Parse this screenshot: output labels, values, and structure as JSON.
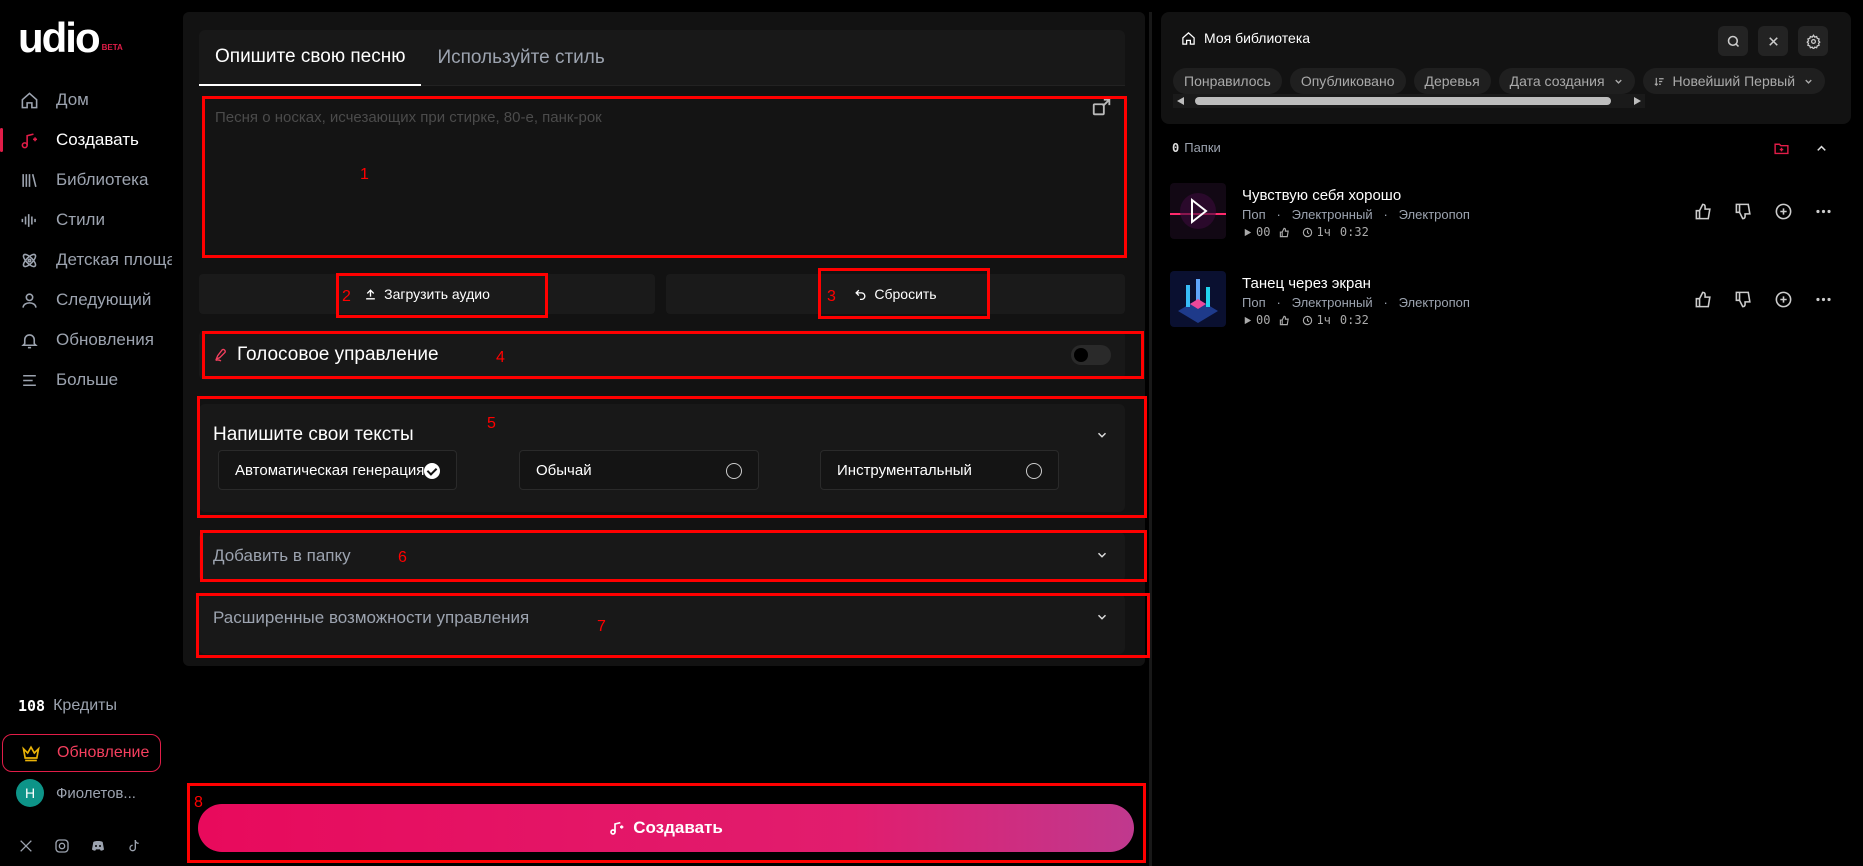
{
  "brand": {
    "logo": "udio",
    "beta": "BETA"
  },
  "sidebar": {
    "items": [
      {
        "label": "Дом",
        "icon": "home-icon"
      },
      {
        "label": "Создавать",
        "icon": "music-note-icon"
      },
      {
        "label": "Библиотека",
        "icon": "library-icon"
      },
      {
        "label": "Стили",
        "icon": "waveform-icon"
      },
      {
        "label": "Детская площадка",
        "icon": "atom-icon"
      },
      {
        "label": "Следующий",
        "icon": "user-icon"
      },
      {
        "label": "Обновления",
        "icon": "bell-icon"
      },
      {
        "label": "Больше",
        "icon": "menu-icon"
      }
    ],
    "active_index": 1,
    "credits_value": "108",
    "credits_label": "Кредиты",
    "upgrade_label": "Обновление",
    "user_initial": "H",
    "user_name": "Фиолетов..."
  },
  "create": {
    "tabs": [
      "Опишите свою песню",
      "Используйте стиль"
    ],
    "prompt_placeholder": "Песня о носках, исчезающих при стирке, 80-е, панк-рок",
    "upload_label": "Загрузить аудио",
    "reset_label": "Сбросить",
    "voice_title": "Голосовое управление",
    "lyrics_title": "Напишите свои тексты",
    "lyrics_options": [
      "Автоматическая генерация",
      "Обычай",
      "Инструментальный"
    ],
    "lyrics_selected": 0,
    "folder_title": "Добавить в папку",
    "advanced_title": "Расширенные возможности управления",
    "create_button": "Создавать"
  },
  "library": {
    "title": "Моя библиотека",
    "filters": [
      "Понравилось",
      "Опубликовано",
      "Деревья",
      "Дата создания",
      "Новейший Первый"
    ],
    "folders_count": "0",
    "folders_label": "Папки",
    "tracks": [
      {
        "title": "Чувствую себя хорошо",
        "tags": [
          "Поп",
          "Электронный",
          "Электропоп"
        ],
        "plays": "00",
        "age": "1ч",
        "duration": "0:32"
      },
      {
        "title": "Танец через экран",
        "tags": [
          "Поп",
          "Электронный",
          "Электропоп"
        ],
        "plays": "00",
        "age": "1ч",
        "duration": "0:32"
      }
    ]
  },
  "annotations": [
    "1",
    "2",
    "3",
    "4",
    "5",
    "6",
    "7",
    "8"
  ],
  "colors": {
    "accent": "#e11d48",
    "annotation": "#ff0000",
    "background": "#000000",
    "panel": "#121212"
  }
}
